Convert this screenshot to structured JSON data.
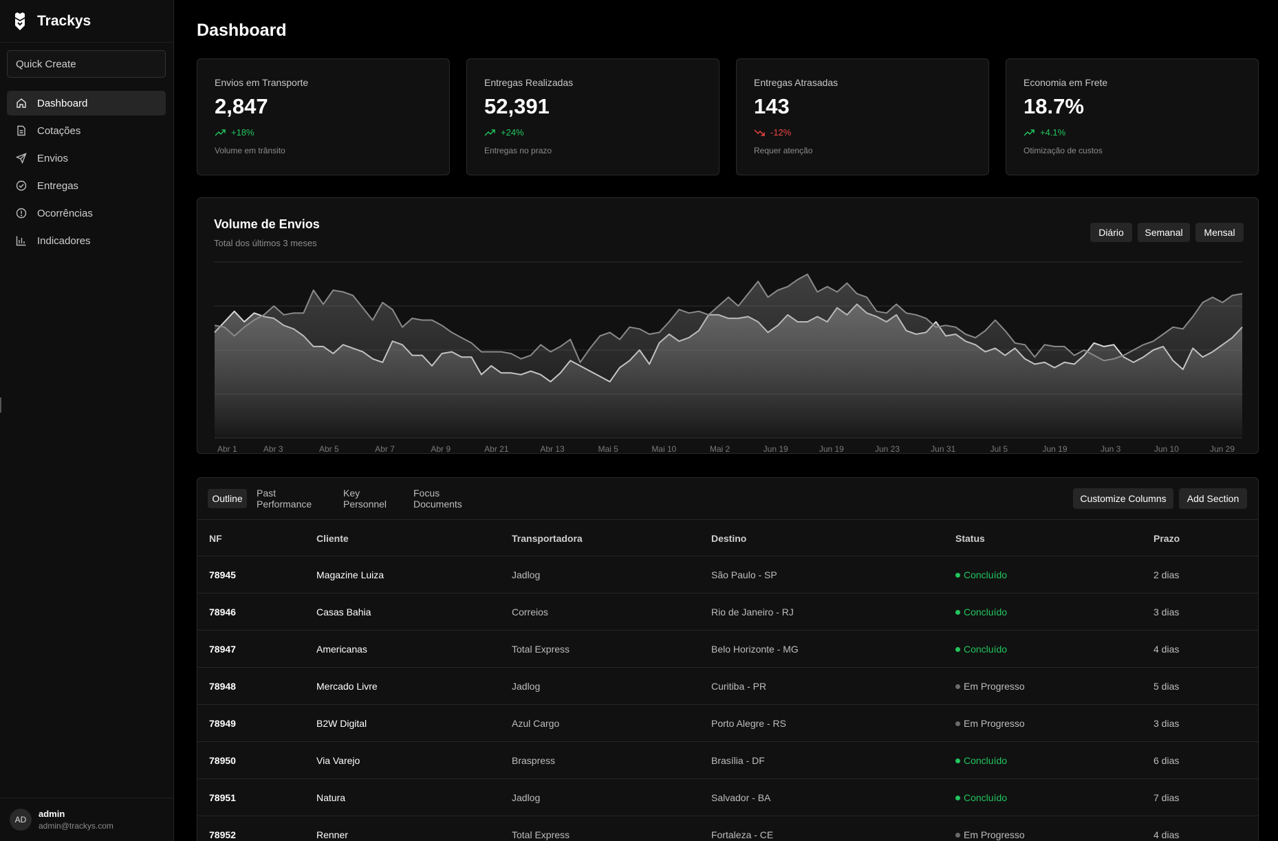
{
  "app": {
    "name": "Trackys"
  },
  "sidebar": {
    "quick_create": "Quick Create",
    "items": [
      {
        "label": "Dashboard",
        "icon": "home-icon",
        "active": true
      },
      {
        "label": "Cotações",
        "icon": "document-icon",
        "active": false
      },
      {
        "label": "Envios",
        "icon": "send-icon",
        "active": false
      },
      {
        "label": "Entregas",
        "icon": "check-circle-icon",
        "active": false
      },
      {
        "label": "Ocorrências",
        "icon": "alert-circle-icon",
        "active": false
      },
      {
        "label": "Indicadores",
        "icon": "bar-chart-icon",
        "active": false
      }
    ],
    "user": {
      "initials": "AD",
      "name": "admin",
      "email": "admin@trackys.com"
    }
  },
  "page": {
    "title": "Dashboard"
  },
  "stats": [
    {
      "label": "Envios em Transporte",
      "value": "2,847",
      "trend": "+18%",
      "direction": "up",
      "sub": "Volume em trânsito"
    },
    {
      "label": "Entregas Realizadas",
      "value": "52,391",
      "trend": "+24%",
      "direction": "up",
      "sub": "Entregas no prazo"
    },
    {
      "label": "Entregas Atrasadas",
      "value": "143",
      "trend": "-12%",
      "direction": "down",
      "sub": "Requer atenção"
    },
    {
      "label": "Economia em Frete",
      "value": "18.7%",
      "trend": "+4.1%",
      "direction": "up",
      "sub": "Otimização de custos"
    }
  ],
  "chart": {
    "title": "Volume de Envios",
    "subtitle": "Total dos últimos 3 meses",
    "ranges": [
      "Diário",
      "Semanal",
      "Mensal"
    ]
  },
  "chart_data": {
    "type": "area",
    "x_ticks": [
      "Abr 1",
      "Abr 3",
      "Abr 5",
      "Abr 7",
      "Abr 9",
      "Abr 21",
      "Abr 13",
      "Mai 5",
      "Mai 10",
      "Mai 2",
      "Jun 19",
      "Jun 19",
      "Jun 23",
      "Jun 31",
      "Jul 5",
      "Jun 19",
      "Jun 3",
      "Jun 10",
      "Jun 29"
    ],
    "ylim": [
      0,
      100
    ],
    "grid": true,
    "series": [
      {
        "values": [
          64,
          63,
          58,
          63,
          67,
          70,
          75,
          70,
          71,
          71,
          84,
          76,
          84,
          83,
          81,
          74,
          67,
          77,
          73,
          63,
          68,
          67,
          67,
          64,
          60,
          57,
          54,
          49,
          49,
          49,
          48,
          45,
          47,
          53,
          49,
          52,
          56,
          43,
          51,
          58,
          60,
          56,
          63,
          62,
          59,
          60,
          66,
          73,
          71,
          72,
          70,
          75,
          80,
          75,
          82,
          89,
          80,
          84,
          86,
          90,
          93,
          83,
          86,
          83,
          88,
          82,
          80,
          72,
          71,
          76,
          71,
          70,
          68,
          63,
          64,
          63,
          59,
          57,
          61,
          67,
          61,
          54,
          53,
          46,
          53,
          52,
          52,
          47,
          50,
          47,
          44,
          45,
          47,
          50,
          53,
          55,
          59,
          63,
          62,
          69,
          77,
          80,
          77,
          81,
          82
        ]
      },
      {
        "values": [
          60,
          66,
          72,
          66,
          71,
          69,
          68,
          64,
          62,
          58,
          52,
          52,
          48,
          53,
          51,
          49,
          45,
          43,
          55,
          53,
          47,
          47,
          41,
          48,
          49,
          46,
          46,
          36,
          41,
          37,
          37,
          36,
          38,
          36,
          32,
          37,
          44,
          41,
          38,
          35,
          32,
          40,
          44,
          50,
          42,
          54,
          59,
          55,
          57,
          61,
          70,
          70,
          68,
          68,
          69,
          66,
          60,
          64,
          70,
          66,
          66,
          69,
          66,
          74,
          70,
          76,
          71,
          69,
          66,
          70,
          61,
          59,
          60,
          66,
          58,
          59,
          55,
          53,
          49,
          51,
          47,
          51,
          45,
          42,
          43,
          40,
          43,
          42,
          47,
          54,
          52,
          53,
          46,
          43,
          46,
          50,
          52,
          44,
          39,
          51,
          46,
          49,
          53,
          57,
          63
        ]
      }
    ]
  },
  "table": {
    "tabs": [
      "Outline",
      "Past Performance",
      "Key Personnel",
      "Focus Documents"
    ],
    "actions": [
      "Customize Columns",
      "Add Section"
    ],
    "columns": [
      "NF",
      "Cliente",
      "Transportadora",
      "Destino",
      "Status",
      "Prazo"
    ],
    "rows": [
      {
        "nf": "78945",
        "cliente": "Magazine Luiza",
        "transportadora": "Jadlog",
        "destino": "São Paulo - SP",
        "status": "Concluído",
        "prazo": "2 dias"
      },
      {
        "nf": "78946",
        "cliente": "Casas Bahia",
        "transportadora": "Correios",
        "destino": "Rio de Janeiro - RJ",
        "status": "Concluído",
        "prazo": "3 dias"
      },
      {
        "nf": "78947",
        "cliente": "Americanas",
        "transportadora": "Total Express",
        "destino": "Belo Horizonte - MG",
        "status": "Concluído",
        "prazo": "4 dias"
      },
      {
        "nf": "78948",
        "cliente": "Mercado Livre",
        "transportadora": "Jadlog",
        "destino": "Curitiba - PR",
        "status": "Em Progresso",
        "prazo": "5 dias"
      },
      {
        "nf": "78949",
        "cliente": "B2W Digital",
        "transportadora": "Azul Cargo",
        "destino": "Porto Alegre - RS",
        "status": "Em Progresso",
        "prazo": "3 dias"
      },
      {
        "nf": "78950",
        "cliente": "Via Varejo",
        "transportadora": "Braspress",
        "destino": "Brasília - DF",
        "status": "Concluído",
        "prazo": "6 dias"
      },
      {
        "nf": "78951",
        "cliente": "Natura",
        "transportadora": "Jadlog",
        "destino": "Salvador - BA",
        "status": "Concluído",
        "prazo": "7 dias"
      },
      {
        "nf": "78952",
        "cliente": "Renner",
        "transportadora": "Total Express",
        "destino": "Fortaleza - CE",
        "status": "Em Progresso",
        "prazo": "4 dias"
      }
    ]
  }
}
